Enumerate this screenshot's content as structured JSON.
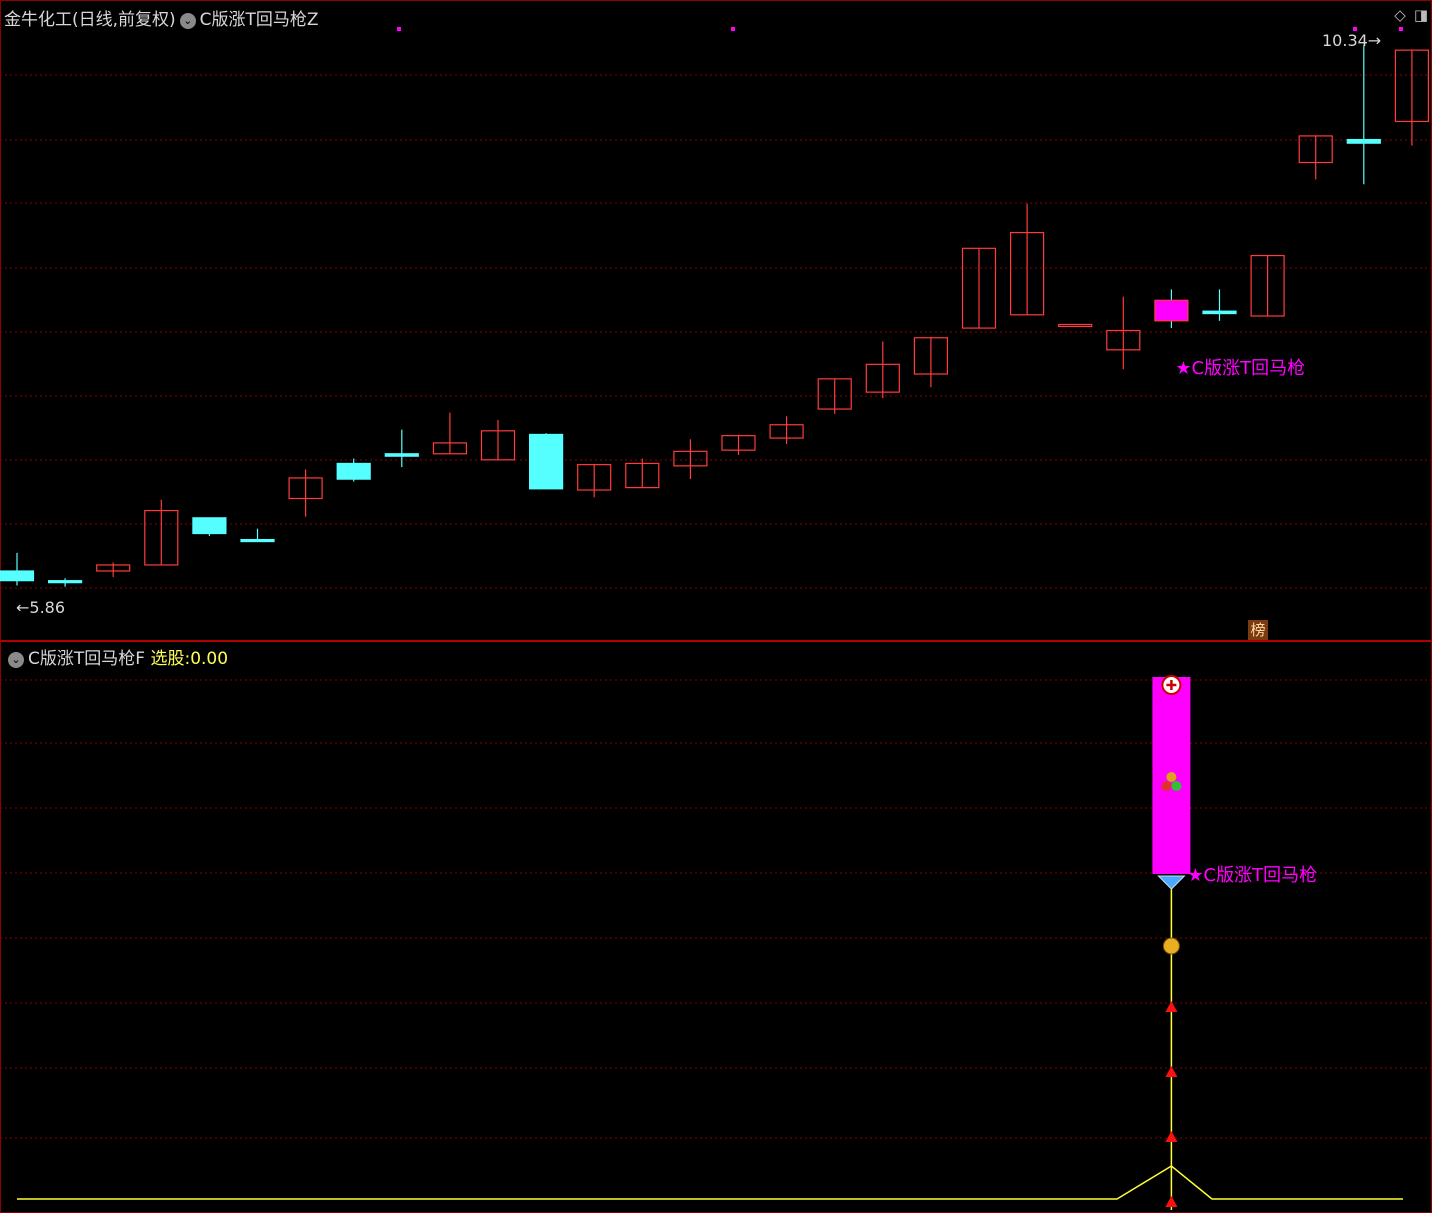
{
  "header": {
    "stock_title": "金牛化工(日线,前复权)",
    "indicator_main": "C版涨T回马枪Z",
    "indicator_sub": "C版涨T回马枪F",
    "select_label": "选股:",
    "select_value": "0.00"
  },
  "badge_label": "榜",
  "colors": {
    "up": "#ff3b3b",
    "down": "#55ffff",
    "signal": "#ff00ff",
    "line": "#ffff33",
    "grid": "#8b0000"
  },
  "chart_data": [
    {
      "type": "candlestick",
      "title": "金牛化工(日线,前复权)",
      "price_labels": {
        "low": "5.86",
        "high": "10.34"
      },
      "signal_label": "★C版涨T回马枪",
      "candles": [
        {
          "o": 5.99,
          "h": 6.14,
          "l": 5.87,
          "c": 5.91
        },
        {
          "o": 5.91,
          "h": 5.93,
          "l": 5.86,
          "c": 5.9
        },
        {
          "o": 5.99,
          "h": 6.06,
          "l": 5.94,
          "c": 6.04
        },
        {
          "o": 6.04,
          "h": 6.58,
          "l": 6.04,
          "c": 6.49
        },
        {
          "o": 6.43,
          "h": 6.43,
          "l": 6.28,
          "c": 6.3
        },
        {
          "o": 6.25,
          "h": 6.34,
          "l": 6.23,
          "c": 6.24
        },
        {
          "o": 6.59,
          "h": 6.83,
          "l": 6.44,
          "c": 6.76
        },
        {
          "o": 6.88,
          "h": 6.92,
          "l": 6.73,
          "c": 6.75
        },
        {
          "o": 6.96,
          "h": 7.16,
          "l": 6.85,
          "c": 6.94
        },
        {
          "o": 6.96,
          "h": 7.3,
          "l": 6.96,
          "c": 7.05
        },
        {
          "o": 6.91,
          "h": 7.24,
          "l": 6.91,
          "c": 7.15
        },
        {
          "o": 7.12,
          "h": 7.13,
          "l": 6.67,
          "c": 6.67
        },
        {
          "o": 6.66,
          "h": 6.87,
          "l": 6.6,
          "c": 6.87
        },
        {
          "o": 6.68,
          "h": 6.92,
          "l": 6.68,
          "c": 6.88
        },
        {
          "o": 6.86,
          "h": 7.08,
          "l": 6.75,
          "c": 6.98
        },
        {
          "o": 6.99,
          "h": 7.07,
          "l": 6.95,
          "c": 7.11
        },
        {
          "o": 7.09,
          "h": 7.27,
          "l": 7.04,
          "c": 7.2
        },
        {
          "o": 7.33,
          "h": 7.45,
          "l": 7.29,
          "c": 7.58
        },
        {
          "o": 7.47,
          "h": 7.89,
          "l": 7.42,
          "c": 7.7
        },
        {
          "o": 7.62,
          "h": 7.72,
          "l": 7.51,
          "c": 7.92
        },
        {
          "o": 8.0,
          "h": 8.0,
          "l": 8.66,
          "c": 8.66
        },
        {
          "o": 8.11,
          "h": 9.03,
          "l": 8.11,
          "c": 8.79
        },
        {
          "o": 8.03,
          "h": 7.99,
          "l": 8.06,
          "c": 8.03
        },
        {
          "o": 7.82,
          "h": 8.26,
          "l": 7.66,
          "c": 7.98
        },
        {
          "o": 8.23,
          "h": 8.32,
          "l": 8.0,
          "c": 8.06
        },
        {
          "o": 8.14,
          "h": 8.32,
          "l": 8.06,
          "c": 8.12
        },
        {
          "o": 8.1,
          "h": 8.6,
          "l": 8.1,
          "c": 8.6
        },
        {
          "o": 9.37,
          "h": 9.36,
          "l": 9.23,
          "c": 9.59
        },
        {
          "o": 9.56,
          "h": 10.34,
          "l": 9.19,
          "c": 9.53
        },
        {
          "o": 9.71,
          "h": 10.3,
          "l": 9.51,
          "c": 10.3
        }
      ],
      "signal_index": 24,
      "ylim": [
        5.75,
        10.45
      ]
    },
    {
      "type": "line",
      "title": "C版涨T回马枪F",
      "signal_label": "★C版涨T回马枪",
      "values": [
        0,
        0,
        0,
        0,
        0,
        0,
        0,
        0,
        0,
        0,
        0,
        0,
        0,
        0,
        0,
        0,
        0,
        0,
        0,
        0,
        0,
        0,
        0,
        0,
        0,
        0,
        1,
        0,
        0,
        0
      ],
      "bar_index": 24,
      "ylim": [
        0,
        1
      ]
    }
  ]
}
